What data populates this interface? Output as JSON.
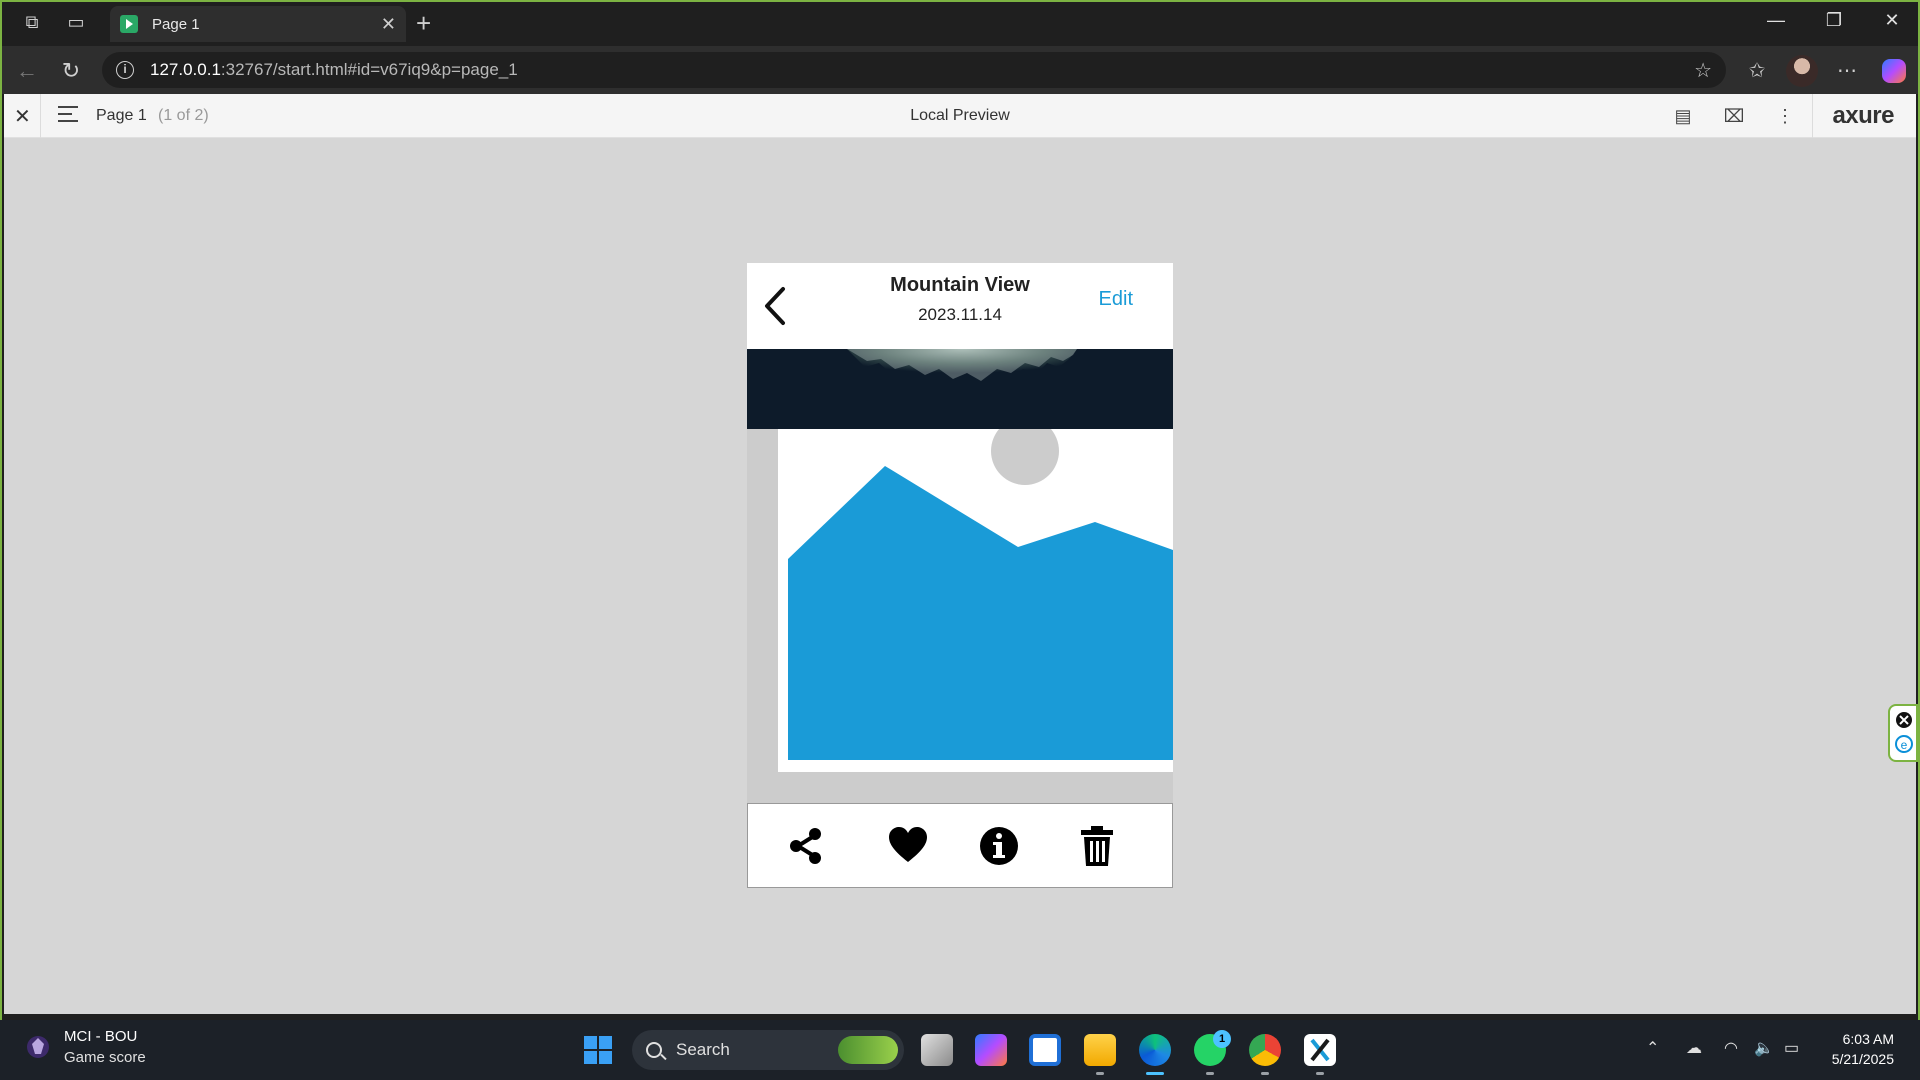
{
  "browser": {
    "tab_title": "Page 1",
    "url_host": "127.0.0.1",
    "url_rest": ":32767/start.html#id=v67iq9&p=page_1"
  },
  "axure": {
    "page_name": "Page 1",
    "page_count": "(1 of 2)",
    "center_title": "Local Preview",
    "logo": "axure"
  },
  "phone": {
    "title": "Mountain View",
    "date": "2023.11.14",
    "edit_label": "Edit",
    "accent_color": "#1a9bd7",
    "actions": [
      "share-icon",
      "heart-icon",
      "info-icon",
      "trash-icon"
    ]
  },
  "taskbar": {
    "weather_line1": "MCI - BOU",
    "weather_line2": "Game score",
    "search_label": "Search",
    "time": "6:03 AM",
    "date": "5/21/2025",
    "whatsapp_badge": "1"
  }
}
